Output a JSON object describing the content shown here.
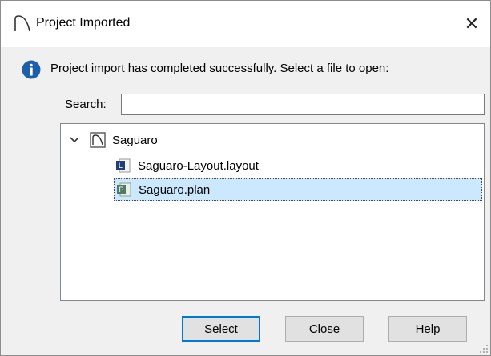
{
  "window": {
    "title": "Project Imported",
    "close_glyph": "✕"
  },
  "message": {
    "icon": "info-icon",
    "text": "Project import has completed successfully.  Select a file to open:"
  },
  "search": {
    "label": "Search:",
    "value": "",
    "placeholder": ""
  },
  "tree": {
    "root": {
      "label": "Saguaro",
      "expanded": true,
      "icon": "project-folder-icon"
    },
    "children": [
      {
        "label": "Saguaro-Layout.layout",
        "icon": "layout-file-icon",
        "selected": false
      },
      {
        "label": "Saguaro.plan",
        "icon": "plan-file-icon",
        "selected": true
      }
    ]
  },
  "buttons": {
    "select": "Select",
    "close": "Close",
    "help": "Help"
  },
  "colors": {
    "selection": "#cce8ff",
    "default_button_border": "#0078d7",
    "info_blue": "#1d5fa8"
  }
}
